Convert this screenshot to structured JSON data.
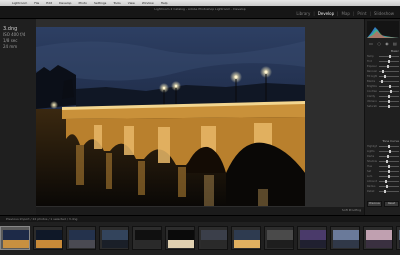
{
  "menubar": {
    "apple": "",
    "items": [
      "Lightroom",
      "File",
      "Edit",
      "Develop",
      "Photo",
      "Settings",
      "Tools",
      "View",
      "Window",
      "Help"
    ]
  },
  "app": {
    "window_title": "Lightroom 2 Catalog - Adobe Photoshop Lightroom - Develop"
  },
  "modules": [
    {
      "label": "Library",
      "active": false
    },
    {
      "label": "Develop",
      "active": true
    },
    {
      "label": "Map",
      "active": false
    },
    {
      "label": "Print",
      "active": false
    },
    {
      "label": "Slideshow",
      "active": false
    }
  ],
  "image_info": {
    "title": "3.dng",
    "line1": "ISO 400 f/4",
    "line2": "1/8 sec",
    "line3": "24 mm"
  },
  "histogram": {
    "colors": [
      "#3fa0ff",
      "#48d46a",
      "#ff4b4b"
    ]
  },
  "quick_tools": [
    "crop-icon",
    "spot-icon",
    "redeye-icon",
    "gradient-icon"
  ],
  "basic_panel": {
    "title": "Basic",
    "sliders": [
      {
        "label": "Temp",
        "value": 0.55
      },
      {
        "label": "Tint",
        "value": 0.5
      },
      {
        "label": "Exposure",
        "value": 0.45
      },
      {
        "label": "Recovery",
        "value": 0.2
      },
      {
        "label": "Fill Light",
        "value": 0.3
      },
      {
        "label": "Blacks",
        "value": 0.15
      },
      {
        "label": "Brightness",
        "value": 0.55
      },
      {
        "label": "Contrast",
        "value": 0.6
      },
      {
        "label": "Clarity",
        "value": 0.5
      },
      {
        "label": "Vibrance",
        "value": 0.5
      },
      {
        "label": "Saturation",
        "value": 0.5
      }
    ]
  },
  "tone_panel": {
    "title": "Tone Curve",
    "sliders": [
      {
        "label": "Highlights",
        "value": 0.5
      },
      {
        "label": "Lights",
        "value": 0.55
      },
      {
        "label": "Darks",
        "value": 0.45
      },
      {
        "label": "Shadows",
        "value": 0.4
      },
      {
        "label": "Hue",
        "value": 0.5
      },
      {
        "label": "Sat",
        "value": 0.5
      },
      {
        "label": "Lum",
        "value": 0.5
      },
      {
        "label": "Amount",
        "value": 0.35
      },
      {
        "label": "Radius",
        "value": 0.4
      },
      {
        "label": "Detail",
        "value": 0.3
      }
    ]
  },
  "panel_buttons": {
    "previous": "Previous",
    "reset": "Reset"
  },
  "view_toolbar": {
    "label": "Soft Proofing"
  },
  "filmstrip": {
    "path": "Previous Import  /  22 photos /  1 selected / 3.dng",
    "selected_index": 0,
    "thumbs": [
      {
        "name": "thumb-bridge-dusk",
        "sky": "#1d2a48",
        "ground": "#c89040"
      },
      {
        "name": "thumb-bridge-night",
        "sky": "#0f1828",
        "ground": "#c88a38"
      },
      {
        "name": "thumb-river-lights",
        "sky": "#24324c",
        "ground": "#4a4a52"
      },
      {
        "name": "thumb-cityscape",
        "sky": "#33445c",
        "ground": "#1a1f28"
      },
      {
        "name": "thumb-dome",
        "sky": "#101010",
        "ground": "#2a2a2a"
      },
      {
        "name": "thumb-street-lamps",
        "sky": "#0a0a0a",
        "ground": "#e0d0b0"
      },
      {
        "name": "thumb-facade",
        "sky": "#3b3f4a",
        "ground": "#2a2a2a"
      },
      {
        "name": "thumb-bridge-arches",
        "sky": "#2e3b50",
        "ground": "#e0b060"
      },
      {
        "name": "thumb-monument",
        "sky": "#4a4a4a",
        "ground": "#1e1e1e"
      },
      {
        "name": "thumb-purple-sky",
        "sky": "#4a3a6a",
        "ground": "#202030"
      },
      {
        "name": "thumb-skyline",
        "sky": "#6a7a9a",
        "ground": "#303848"
      },
      {
        "name": "thumb-sunset",
        "sky": "#c0a0b0",
        "ground": "#3a3040"
      },
      {
        "name": "thumb-tower",
        "sky": "#5a6a80",
        "ground": "#202028"
      }
    ]
  }
}
